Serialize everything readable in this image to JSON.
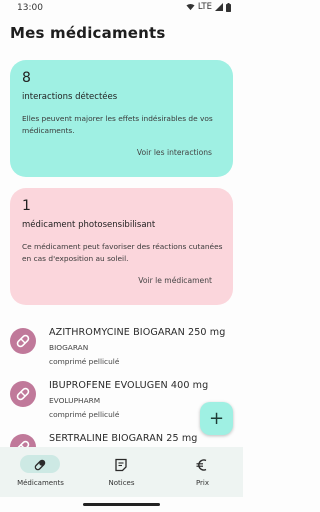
{
  "status_bar": {
    "time": "13:00",
    "network": "LTE"
  },
  "page": {
    "title": "Mes médicaments"
  },
  "interactions_card": {
    "count": "8",
    "heading": "interactions détectées",
    "description": "Elles peuvent majorer les effets indésirables de vos médicaments.",
    "link": "Voir les interactions",
    "color": "#9ff0e3"
  },
  "photosensitivity_card": {
    "count": "1",
    "heading": "médicament photosensibilisant",
    "description": "Ce médicament peut favoriser des réactions cutanées en cas d'exposition au soleil.",
    "link": "Voir le médicament",
    "color": "#fbd6dc"
  },
  "medications": [
    {
      "name": "AZITHROMYCINE BIOGARAN 250 mg",
      "lab": "BIOGARAN",
      "form": "comprimé pelliculé",
      "icon": "pill-icon"
    },
    {
      "name": "IBUPROFENE EVOLUGEN 400 mg",
      "lab": "EVOLUPHARM",
      "form": "comprimé pelliculé",
      "icon": "pill-icon"
    },
    {
      "name": "SERTRALINE BIOGARAN 25 mg",
      "lab": "",
      "form": "",
      "icon": "pill-icon"
    }
  ],
  "fab": {
    "label": "+"
  },
  "bottom_nav": [
    {
      "label": "Médicaments",
      "icon": "pill-icon",
      "active": true
    },
    {
      "label": "Notices",
      "icon": "document-icon",
      "active": false
    },
    {
      "label": "Prix",
      "icon": "euro-icon",
      "active": false
    }
  ]
}
